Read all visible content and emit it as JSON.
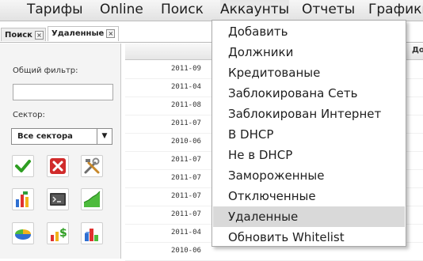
{
  "menubar": {
    "items": [
      {
        "label": "Тарифы"
      },
      {
        "label": "Online"
      },
      {
        "label": "Поиск"
      },
      {
        "label": "Аккаунты"
      },
      {
        "label": "Отчеты"
      },
      {
        "label": "Графики"
      }
    ],
    "active_index": 3
  },
  "tabs": [
    {
      "label": "Поиск",
      "close_icon": "close-icon"
    },
    {
      "label": "Удаленные",
      "close_icon": "close-icon"
    }
  ],
  "left_panel": {
    "filter_label": "Общий фильтр:",
    "filter_value": "",
    "sector_label": "Сектор:",
    "sector_selected": "Все сектора",
    "buttons": [
      {
        "icon": "checkmark-icon"
      },
      {
        "icon": "delete-icon"
      },
      {
        "icon": "tools-icon"
      },
      {
        "icon": "bar-chart-icon"
      },
      {
        "icon": "terminal-icon"
      },
      {
        "icon": "area-chart-icon"
      },
      {
        "icon": "pie-chart-icon"
      },
      {
        "icon": "money-icon"
      },
      {
        "icon": "3d-chart-icon"
      }
    ]
  },
  "grid": {
    "right_header": "До",
    "dates": [
      "2011-09",
      "2011-04",
      "2011-08",
      "2011-07",
      "2010-06",
      "2011-07",
      "2011-07",
      "2011-07",
      "2011-07",
      "2011-04",
      "2010-06"
    ]
  },
  "accounts_menu": {
    "items": [
      {
        "label": "Добавить"
      },
      {
        "label": "Должники"
      },
      {
        "label": "Кредитованые"
      },
      {
        "label": "Заблокирована Сеть"
      },
      {
        "label": "Заблокирован Интернет"
      },
      {
        "label": "В DHCP"
      },
      {
        "label": "Не в DHCP"
      },
      {
        "label": "Замороженные"
      },
      {
        "label": "Отключенные"
      },
      {
        "label": "Удаленные"
      },
      {
        "label": "Обновить Whitelist"
      }
    ],
    "highlighted_index": 9
  }
}
